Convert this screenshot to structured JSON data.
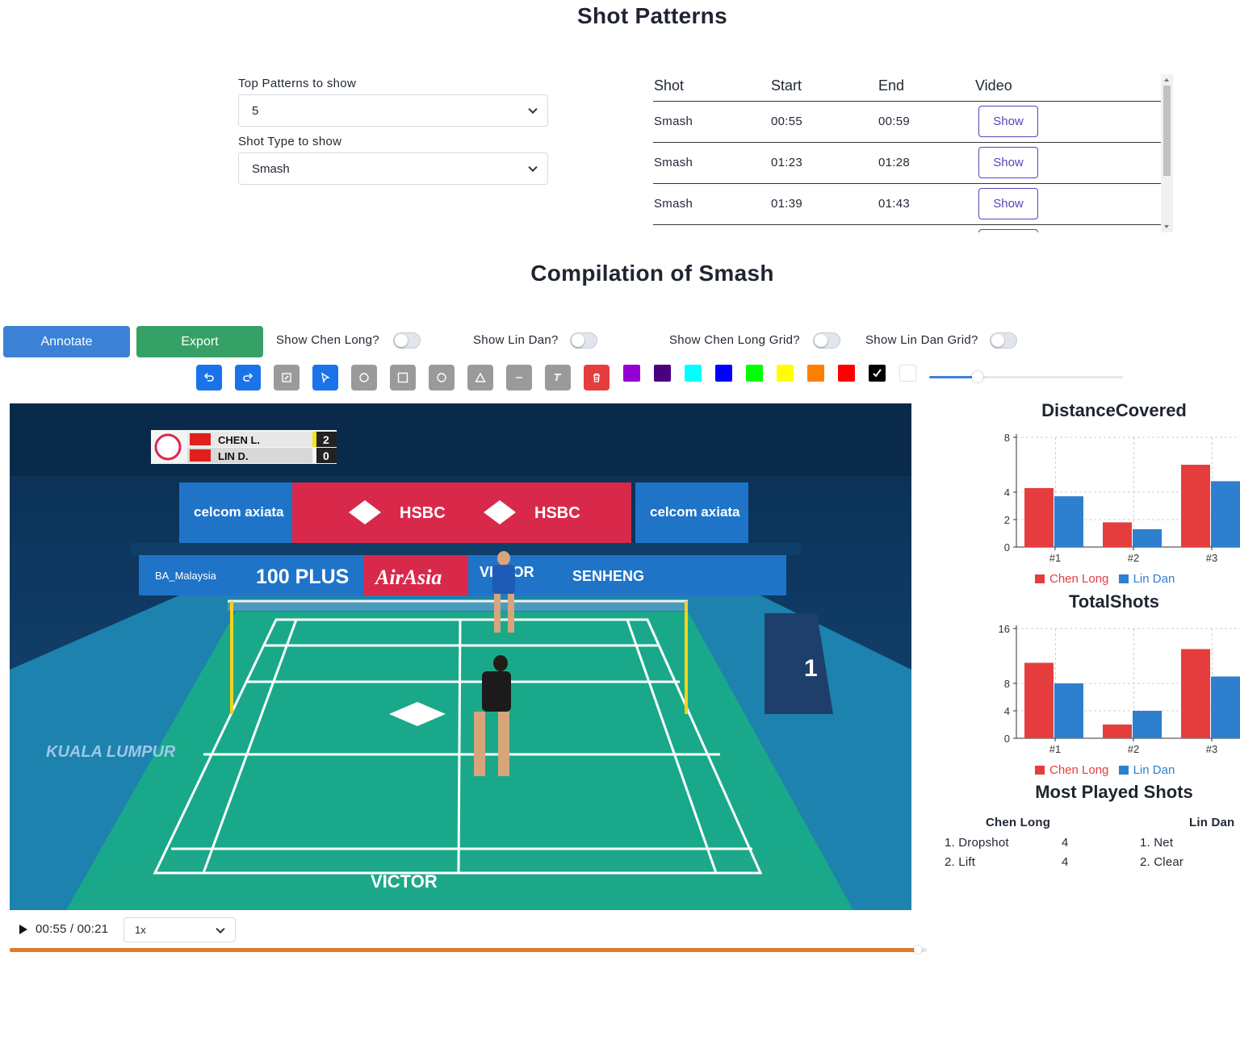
{
  "shot_patterns": {
    "title": "Shot Patterns",
    "top_patterns_label": "Top Patterns to show",
    "top_patterns_value": "5",
    "shot_type_label": "Shot Type to show",
    "shot_type_value": "Smash"
  },
  "table": {
    "columns": [
      "Shot",
      "Start",
      "End",
      "Video"
    ],
    "rows": [
      {
        "shot": "Smash",
        "start": "00:55",
        "end": "00:59",
        "video": "Show"
      },
      {
        "shot": "Smash",
        "start": "01:23",
        "end": "01:28",
        "video": "Show"
      },
      {
        "shot": "Smash",
        "start": "01:39",
        "end": "01:43",
        "video": "Show"
      }
    ]
  },
  "compilation": {
    "title": "Compilation of Smash",
    "annotate_label": "Annotate",
    "export_label": "Export",
    "toggles": {
      "chen_long": "Show Chen Long?",
      "lin_dan": "Show Lin Dan?",
      "chen_long_grid": "Show Chen Long Grid?",
      "lin_dan_grid": "Show Lin Dan Grid?"
    },
    "tools": [
      "undo-icon",
      "redo-icon",
      "edit-icon",
      "pointer-icon",
      "circle-icon",
      "square-icon",
      "ellipse-icon",
      "triangle-icon",
      "line-icon",
      "text-icon",
      "trash-icon"
    ],
    "swatch_colors": [
      "#9400d3",
      "#4b0082",
      "#00ffff",
      "#0000ff",
      "#00ff00",
      "#ffff00",
      "#ff7f00",
      "#ff0000",
      "#000000",
      "#ffffff"
    ],
    "brush_size_fraction": 0.25
  },
  "video": {
    "time": "00:55 / 00:21",
    "speed": "1x",
    "progress_fraction": 0.99,
    "scoreboard": {
      "player1": "CHEN L.",
      "score1": "2",
      "player2": "LIN D.",
      "score2": "0"
    },
    "sponsors": {
      "celcom": "celcom axiata",
      "hsbc": "HSBC",
      "ba": "BA_Malaysia",
      "plus": "100 PLUS",
      "airasia": "AirAsia",
      "victor": "VICTOR",
      "senheng": "SENHENG",
      "kl": "KUALA LUMPUR"
    }
  },
  "colors": {
    "chen_long": "#e53d3d",
    "lin_dan": "#2f7fcf",
    "annotate_btn": "#3b82d6",
    "export_btn": "#36a167",
    "show_btn": "#5b3fb8"
  },
  "charts": {
    "most_played_title": "Most Played Shots",
    "most_played": {
      "chen_long_header": "Chen Long",
      "lin_dan_header": "Lin Dan",
      "chen_long": [
        {
          "shot": "1. Dropshot",
          "count": "4"
        },
        {
          "shot": "2. Lift",
          "count": "4"
        }
      ],
      "lin_dan": [
        {
          "shot": "1. Net"
        },
        {
          "shot": "2. Clear"
        }
      ]
    }
  },
  "chart_data": [
    {
      "type": "bar",
      "title": "DistanceCovered",
      "categories": [
        "#1",
        "#2",
        "#3"
      ],
      "series": [
        {
          "name": "Chen Long",
          "values": [
            4.3,
            1.8,
            6.0
          ]
        },
        {
          "name": "Lin Dan",
          "values": [
            3.7,
            1.3,
            4.8
          ]
        }
      ],
      "yticks": [
        0,
        2,
        4,
        8
      ],
      "ylim": [
        0,
        8
      ],
      "grid": true,
      "legend": "bottom"
    },
    {
      "type": "bar",
      "title": "TotalShots",
      "categories": [
        "#1",
        "#2",
        "#3"
      ],
      "series": [
        {
          "name": "Chen Long",
          "values": [
            11,
            2,
            13
          ]
        },
        {
          "name": "Lin Dan",
          "values": [
            8,
            4,
            9
          ]
        }
      ],
      "yticks": [
        0,
        4,
        8,
        16
      ],
      "ylim": [
        0,
        16
      ],
      "grid": true,
      "legend": "bottom"
    }
  ]
}
